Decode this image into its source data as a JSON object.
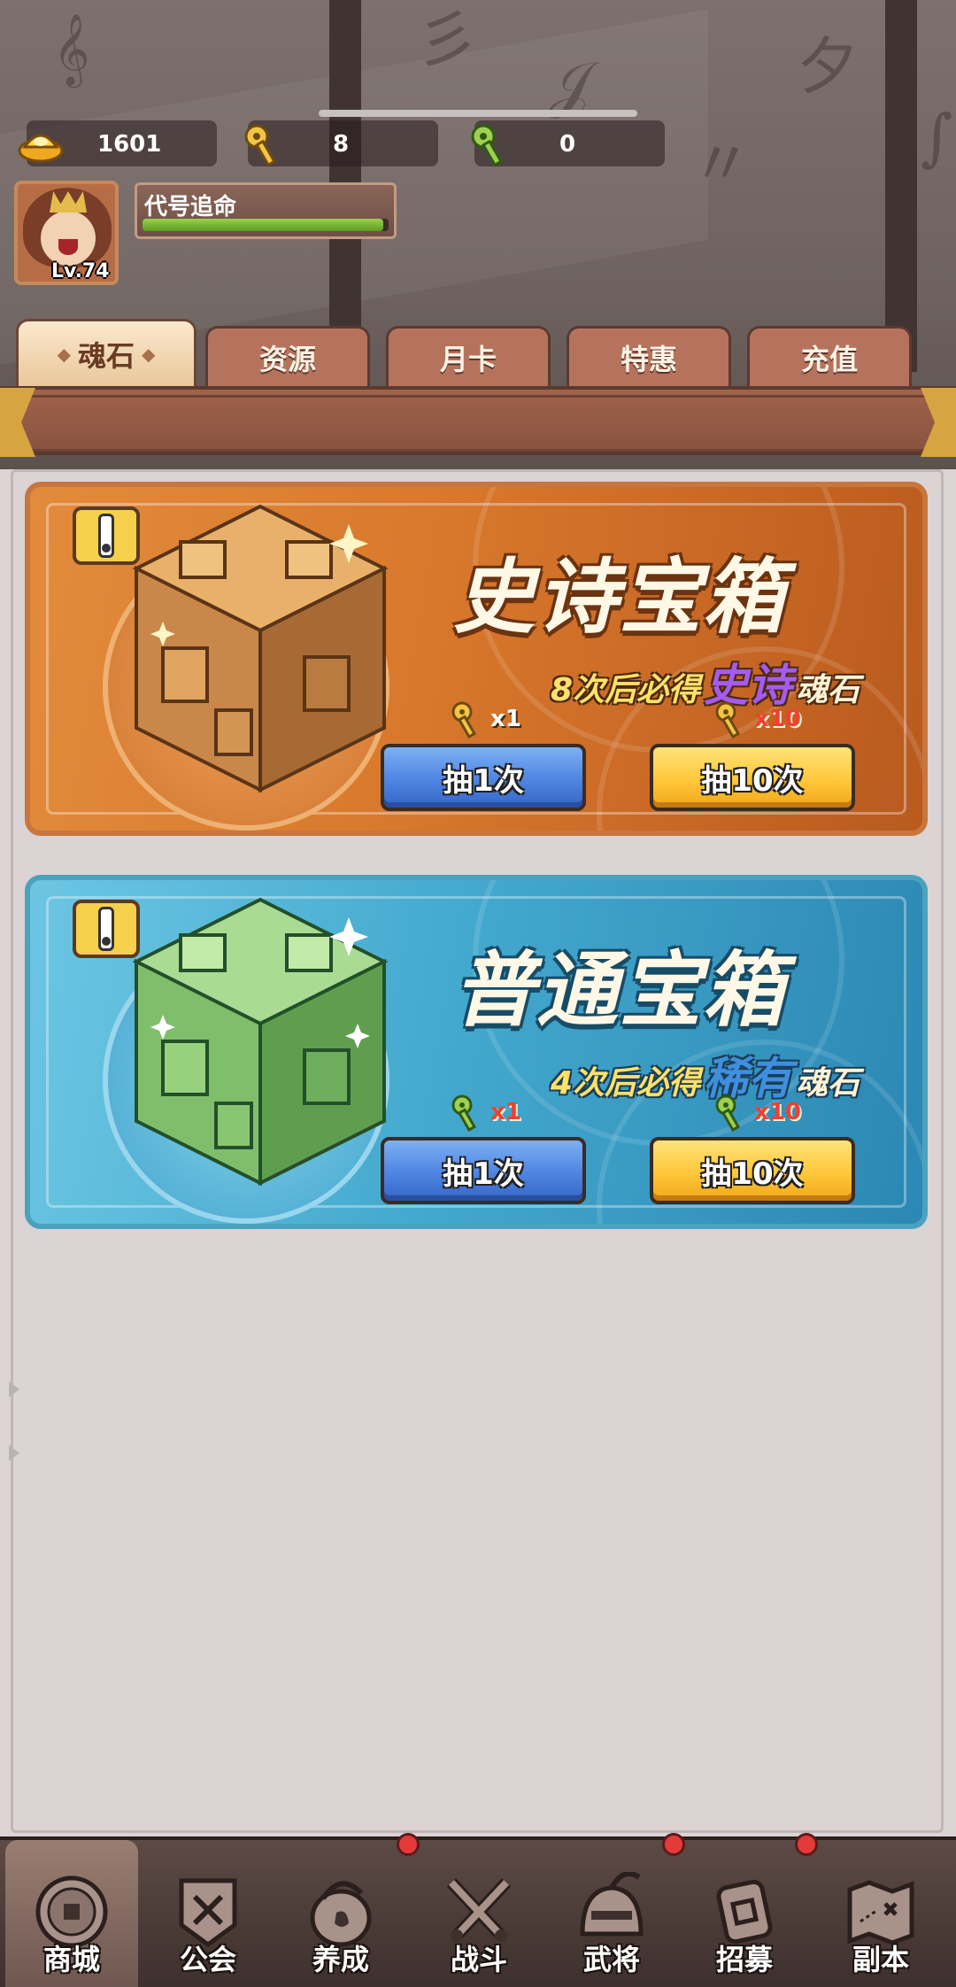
{
  "currencies": [
    {
      "icon": "gold-ingot-icon",
      "value": "1601"
    },
    {
      "icon": "gold-key-icon",
      "value": "8"
    },
    {
      "icon": "green-key-icon",
      "value": "0"
    }
  ],
  "player": {
    "name": "代号追命",
    "level": "Lv.74",
    "xp_fraction": 0.98
  },
  "tabs": [
    {
      "label": "魂石",
      "active": true
    },
    {
      "label": "资源",
      "active": false
    },
    {
      "label": "月卡",
      "active": false
    },
    {
      "label": "特惠",
      "active": false
    },
    {
      "label": "充值",
      "active": false
    }
  ],
  "chests": [
    {
      "title": "史诗宝箱",
      "guarantee_prefix": "8次后必得",
      "rarity": "史诗",
      "soul": "魂石",
      "single_cost": "x1",
      "ten_cost": "x10",
      "single_label": "抽1次",
      "ten_label": "抽10次",
      "theme": "orange"
    },
    {
      "title": "普通宝箱",
      "guarantee_prefix": "4次后必得",
      "rarity": "稀有",
      "soul": "魂石",
      "single_cost": "x1",
      "ten_cost": "x10",
      "single_label": "抽1次",
      "ten_label": "抽10次",
      "theme": "blue"
    }
  ],
  "bottom_nav": [
    {
      "label": "商城",
      "icon": "coin-icon",
      "active": true,
      "badge": false
    },
    {
      "label": "公会",
      "icon": "guild-banner-icon",
      "active": false,
      "badge": false
    },
    {
      "label": "养成",
      "icon": "dragon-egg-icon",
      "active": false,
      "badge": true
    },
    {
      "label": "战斗",
      "icon": "crossed-swords-icon",
      "active": false,
      "badge": false
    },
    {
      "label": "武将",
      "icon": "helmet-icon",
      "active": false,
      "badge": true
    },
    {
      "label": "招募",
      "icon": "recruit-token-icon",
      "active": false,
      "badge": true
    },
    {
      "label": "副本",
      "icon": "map-scroll-icon",
      "active": false,
      "badge": false
    }
  ],
  "colors": {
    "epic_card": "#d8782c",
    "normal_card": "#45aacf",
    "epic_rarity": "#a65bf0",
    "rare_rarity": "#3f8edf",
    "badge": "#e43a3a"
  }
}
